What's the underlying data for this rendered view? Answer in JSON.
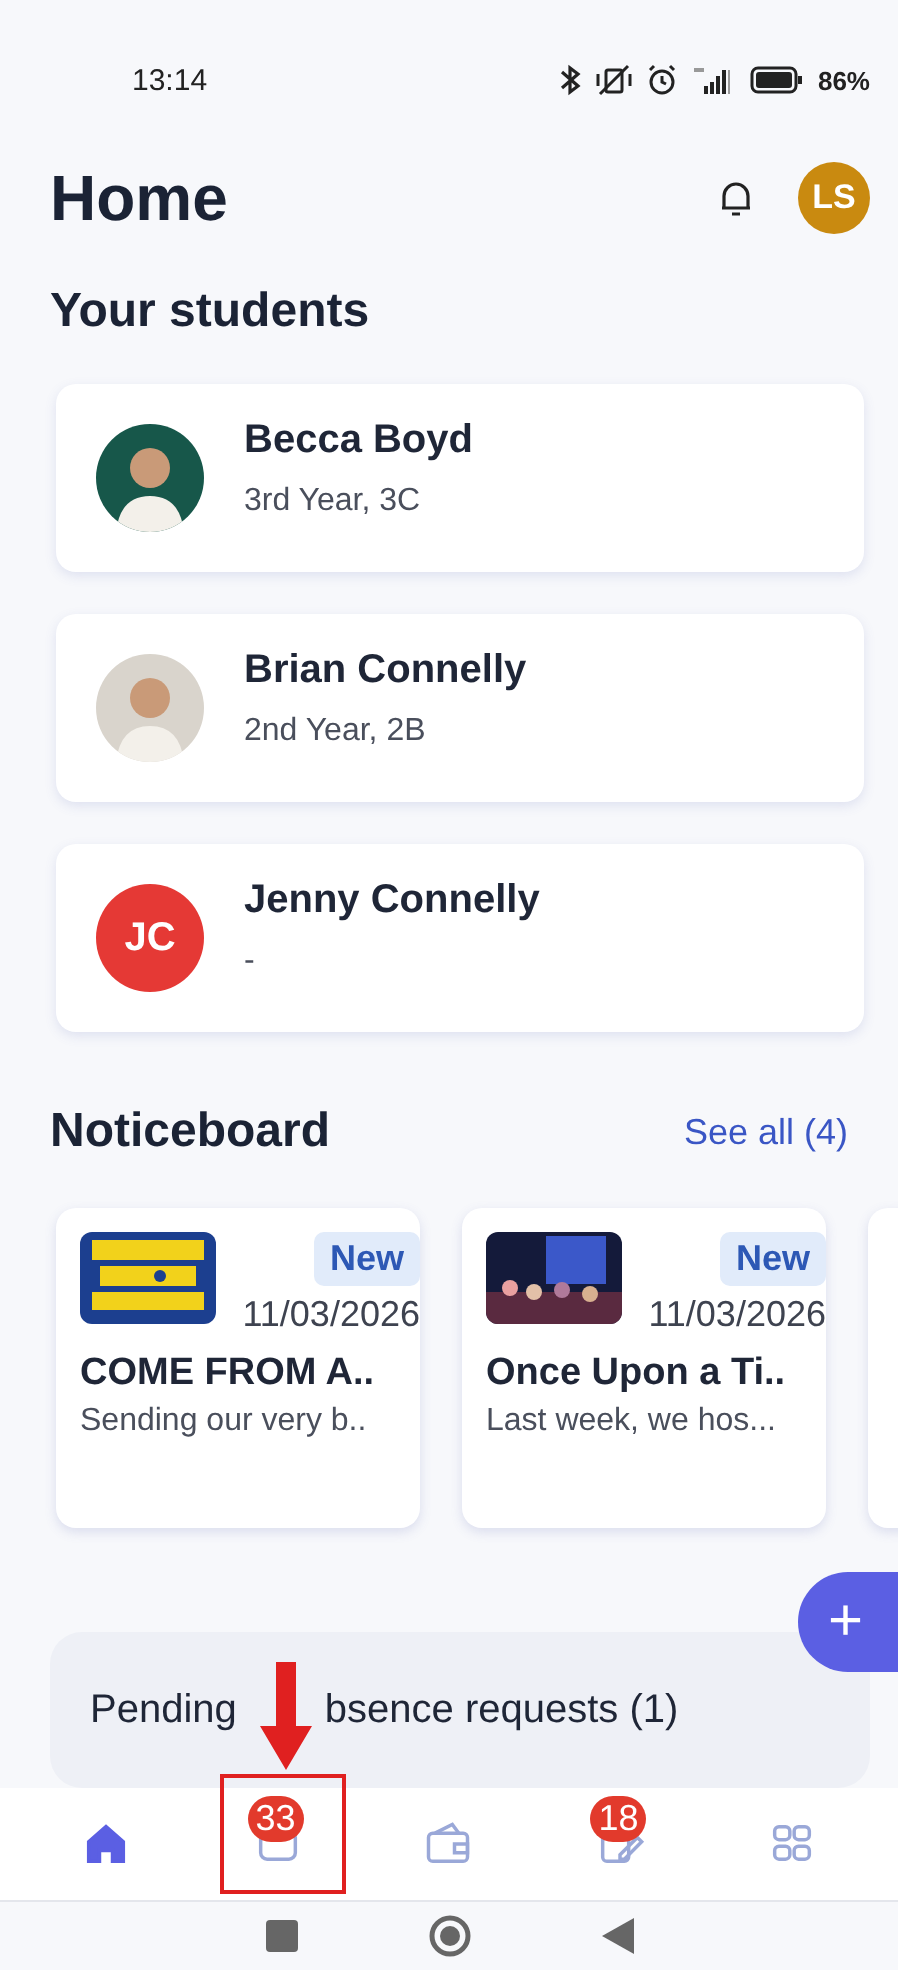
{
  "status_bar": {
    "time": "13:14",
    "battery": "86%"
  },
  "header": {
    "title": "Home",
    "avatar_initials": "LS"
  },
  "students_heading": "Your students",
  "students": [
    {
      "name": "Becca Boyd",
      "detail": "3rd Year, 3C"
    },
    {
      "name": "Brian Connelly",
      "detail": "2nd Year, 2B"
    },
    {
      "name": "Jenny Connelly",
      "detail": "-",
      "avatar": {
        "kind": "initials",
        "initials": "JC",
        "color": "#e53935"
      }
    }
  ],
  "noticeboard": {
    "title": "Noticeboard",
    "see_all": "See all (4)",
    "notices": [
      {
        "badge": "New",
        "date": "11/03/2026",
        "title": "COME FROM A..",
        "excerpt": "Sending our very b..",
        "picture": {
          "kind": "poster"
        }
      },
      {
        "badge": "New",
        "date": "11/03/2026",
        "title": "Once Upon a Ti..",
        "excerpt": "Last week, we hos...",
        "picture": {
          "kind": "stage"
        }
      }
    ]
  },
  "fab": {
    "label": "+"
  },
  "pending": {
    "title_parts": [
      "Pending",
      "bsence requests (1)"
    ]
  },
  "nav": [
    {
      "kind": "home",
      "selected": true
    },
    {
      "kind": "inbox",
      "selected": false,
      "badge": "33",
      "highlighted": true
    },
    {
      "kind": "wallet",
      "selected": false
    },
    {
      "kind": "edit",
      "selected": false,
      "badge": "18"
    },
    {
      "kind": "grid",
      "selected": false
    }
  ]
}
